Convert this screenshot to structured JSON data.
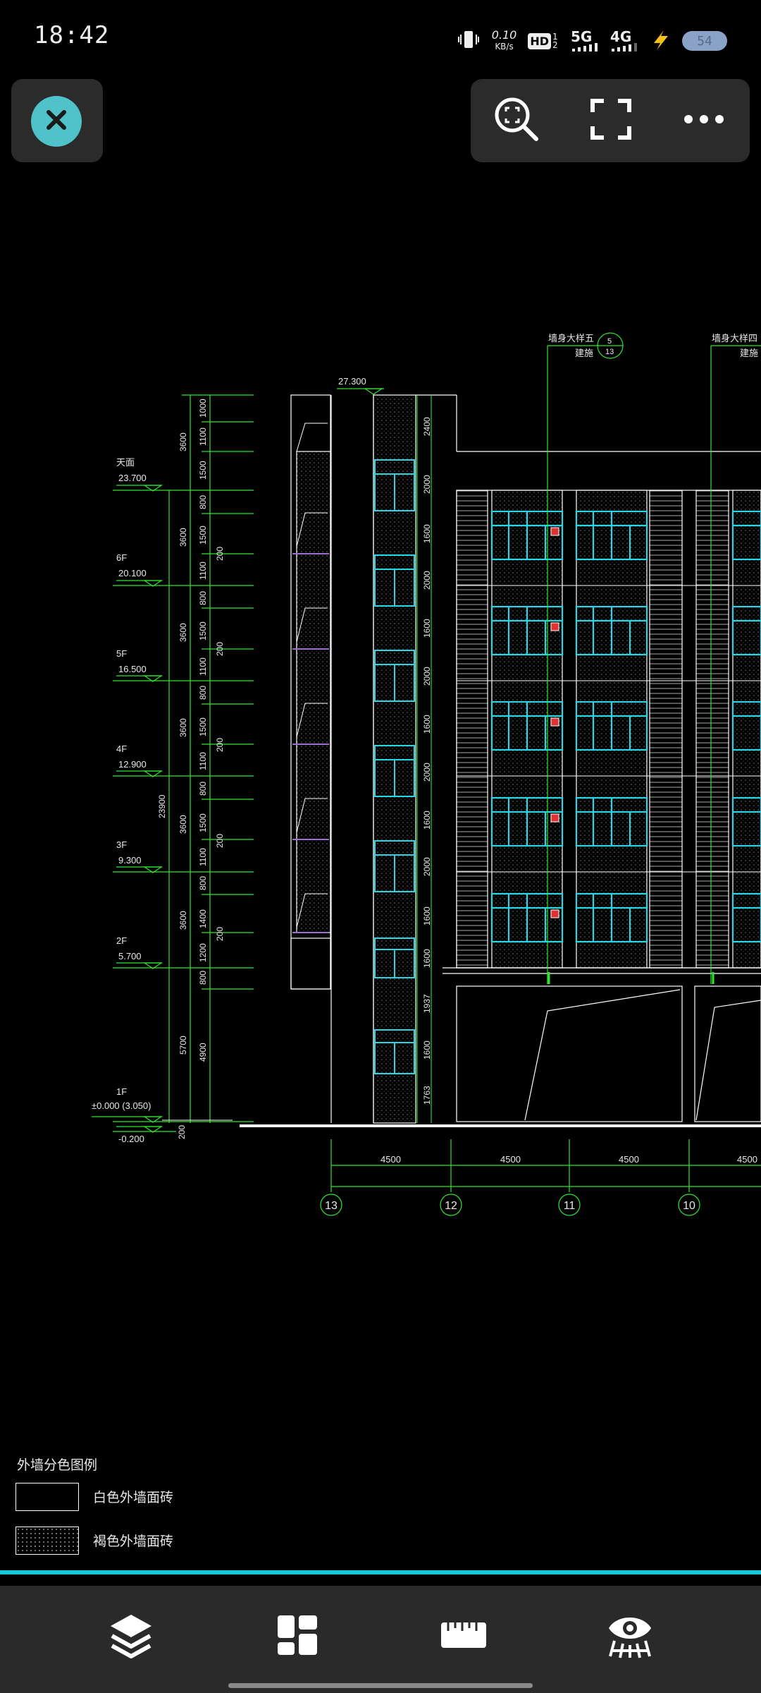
{
  "status_bar": {
    "time": "18:42",
    "net_speed_value": "0.10",
    "net_speed_unit": "KB/s",
    "hd_label": "HD",
    "sim_index": "1 2",
    "network_1": "5G",
    "network_2": "4G",
    "battery": "54"
  },
  "toolbar": {
    "close_icon": "close-icon",
    "zoom_extent_icon": "zoom-extent-icon",
    "fullscreen_icon": "fullscreen-icon",
    "more_icon": "more-icon"
  },
  "drawing": {
    "top_elevation": "27.300",
    "detail_label_1": "墙身大样五",
    "detail_sub_1": "建施",
    "detail_num_1": "5",
    "detail_den_1": "13",
    "detail_label_2": "墙身大样四",
    "detail_sub_2": "建施",
    "levels": [
      {
        "name": "天面",
        "elev": "23.700"
      },
      {
        "name": "6F",
        "elev": "20.100"
      },
      {
        "name": "5F",
        "elev": "16.500"
      },
      {
        "name": "4F",
        "elev": "12.900"
      },
      {
        "name": "3F",
        "elev": "9.300"
      },
      {
        "name": "2F",
        "elev": "5.700"
      },
      {
        "name": "1F",
        "elev": "±0.000 (3.050)"
      }
    ],
    "ground_elev": "-0.200",
    "total_height": "23900",
    "bottom_dim": "200",
    "story_dims": [
      "3600",
      "3600",
      "3600",
      "3600",
      "3600",
      "3600",
      "5700"
    ],
    "sub_dims_left": [
      "1000",
      "1100",
      "1500",
      "800",
      "1500",
      "1100",
      "800",
      "1500",
      "1100",
      "800",
      "1500",
      "1100",
      "800",
      "1500",
      "1100",
      "800",
      "1400",
      "1200",
      "800",
      "4900"
    ],
    "sub_dims_200": [
      "200",
      "200",
      "200",
      "200",
      "200"
    ],
    "sub_dims_right": [
      "2400",
      "2000",
      "1600",
      "2000",
      "1600",
      "2000",
      "1600",
      "2000",
      "1600",
      "2000",
      "1600",
      "1600",
      "1937",
      "1600",
      "1763"
    ],
    "bay_dims": [
      "4500",
      "4500",
      "4500",
      "4500"
    ],
    "axes": [
      "13",
      "12",
      "11",
      "10"
    ]
  },
  "legend": {
    "title": "外墙分色图例",
    "items": [
      {
        "label": "白色外墙面砖"
      },
      {
        "label": "褐色外墙面砖"
      }
    ]
  },
  "bottom_nav": [
    {
      "icon": "layers-icon"
    },
    {
      "icon": "layout-icon"
    },
    {
      "icon": "ruler-icon"
    },
    {
      "icon": "eye-viewer-icon"
    }
  ],
  "colors": {
    "accent": "#18c6d8",
    "close_button": "#4fc3c9",
    "cad_green": "#2ee62e",
    "cad_cyan": "#29d6e6",
    "cad_white": "#ffffff"
  }
}
